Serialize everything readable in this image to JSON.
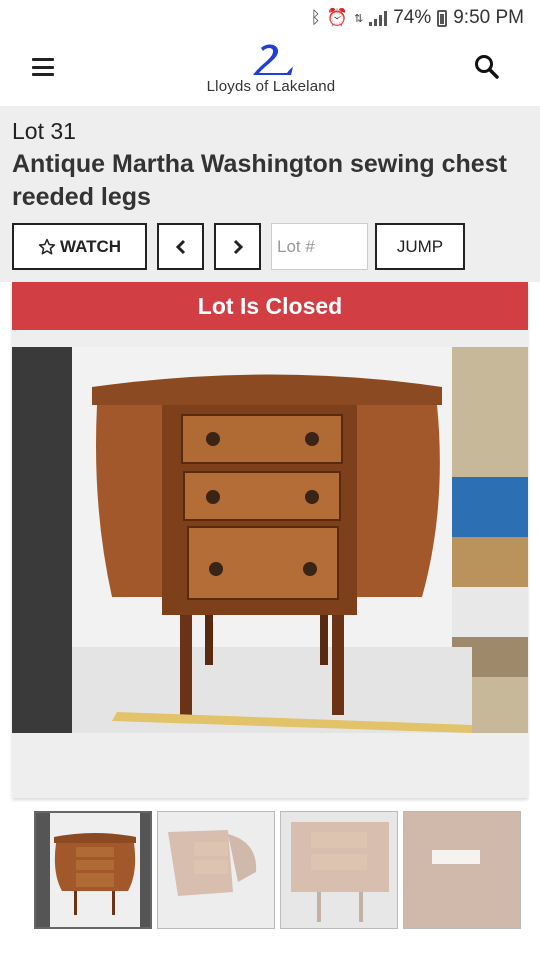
{
  "status_bar": {
    "battery": "74%",
    "time": "9:50 PM",
    "icons": [
      "bluetooth-icon",
      "alarm-icon",
      "data-icon",
      "signal-icon",
      "battery-icon"
    ]
  },
  "header": {
    "logo_text": "Lloyds of Lakeland",
    "menu_icon": "hamburger-menu-icon",
    "search_icon": "search-icon",
    "brand_color": "#1f3fd6"
  },
  "lot": {
    "number_label": "Lot 31",
    "title": "Antique Martha Washington sewing chest reeded legs"
  },
  "nav": {
    "watch_label": "WATCH",
    "watch_icon": "star-outline-icon",
    "prev_icon": "chevron-left-icon",
    "next_icon": "chevron-right-icon",
    "lot_placeholder": "Lot #",
    "jump_label": "JUMP"
  },
  "status": {
    "closed_label": "Lot Is Closed",
    "closed_color": "#d13f45"
  },
  "gallery": {
    "main_image": "sewing-chest-photo",
    "thumbnails": [
      "front-view",
      "side-open-view",
      "close-up-view",
      "label-detail-view"
    ],
    "active_index": 0
  }
}
